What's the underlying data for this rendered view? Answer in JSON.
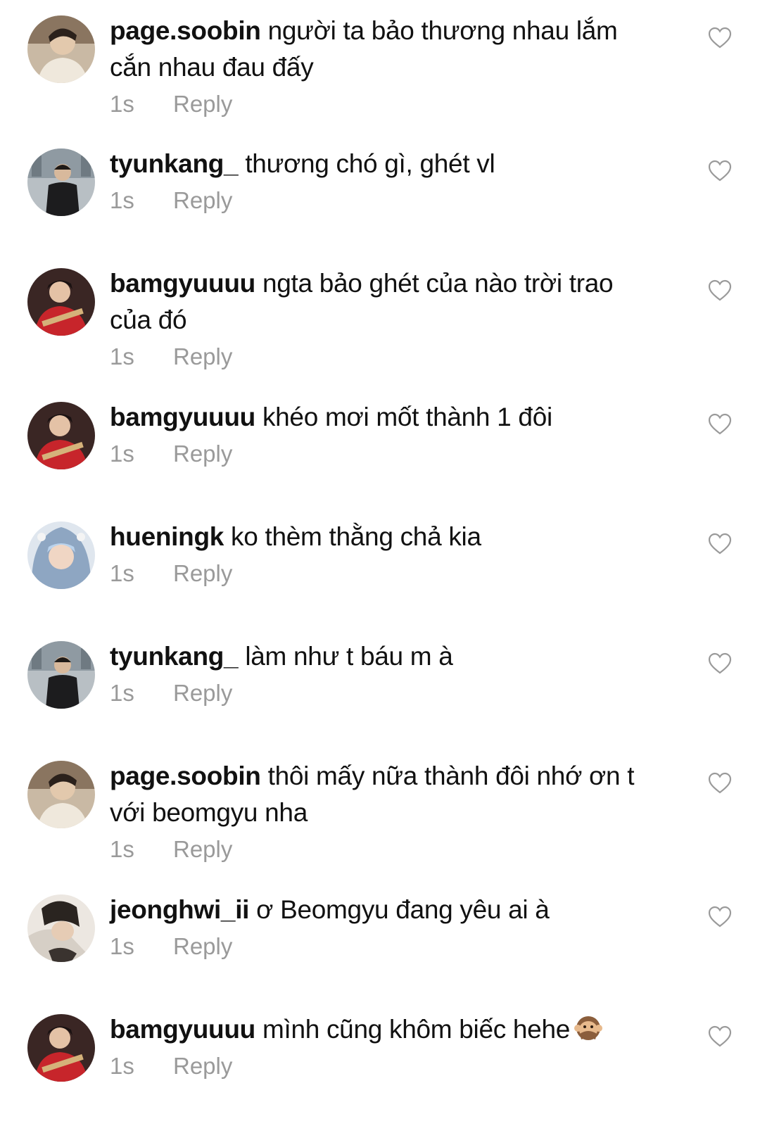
{
  "colors": {
    "text": "#111111",
    "meta": "#9a9a9a",
    "background": "#ffffff"
  },
  "comments": [
    {
      "username": "page.soobin",
      "text": " người ta bảo thương nhau lắm cắn nhau đau đấy",
      "time": "1s",
      "reply": "Reply",
      "avatar": "avatar-soobin"
    },
    {
      "username": "tyunkang_",
      "text": " thương chó gì, ghét vl",
      "time": "1s",
      "reply": "Reply",
      "avatar": "avatar-tyunkang"
    },
    {
      "username": "bamgyuuuu",
      "text": " ngta bảo ghét của nào trời trao của đó",
      "time": "1s",
      "reply": "Reply",
      "avatar": "avatar-bamgyuuuu"
    },
    {
      "username": "bamgyuuuu",
      "text": " khéo mơi mốt thành 1 đôi",
      "time": "1s",
      "reply": "Reply",
      "avatar": "avatar-bamgyuuuu"
    },
    {
      "username": "hueningk",
      "text": " ko thèm thằng chả kia",
      "time": "1s",
      "reply": "Reply",
      "avatar": "avatar-hueningk"
    },
    {
      "username": "tyunkang_",
      "text": " làm như t báu m à",
      "time": "1s",
      "reply": "Reply",
      "avatar": "avatar-tyunkang"
    },
    {
      "username": "page.soobin",
      "text": " thôi mấy nữa thành đôi nhớ ơn t với beomgyu nha",
      "time": "1s",
      "reply": "Reply",
      "avatar": "avatar-soobin"
    },
    {
      "username": "jeonghwi_ii",
      "text": " ơ Beomgyu đang yêu ai à",
      "time": "1s",
      "reply": "Reply",
      "avatar": "avatar-jeonghwi"
    },
    {
      "username": "bamgyuuuu",
      "text": " mình cũng khôm biếc hehe",
      "time": "1s",
      "reply": "Reply",
      "avatar": "avatar-bamgyuuuu",
      "emoji": "speak-no-evil-monkey-icon"
    }
  ]
}
